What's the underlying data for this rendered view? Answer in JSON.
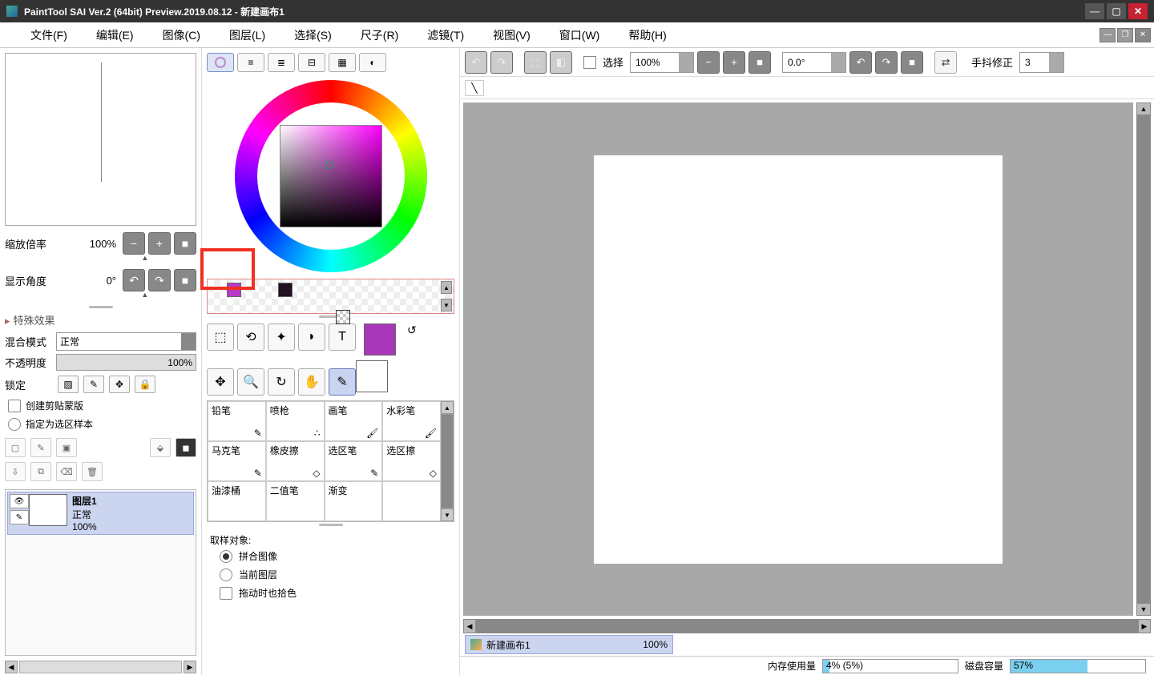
{
  "title": "PaintTool SAI Ver.2 (64bit) Preview.2019.08.12 - 新建画布1",
  "menu": [
    "文件(F)",
    "编辑(E)",
    "图像(C)",
    "图层(L)",
    "选择(S)",
    "尺子(R)",
    "滤镜(T)",
    "视图(V)",
    "窗口(W)",
    "帮助(H)"
  ],
  "nav": {
    "zoom_label": "缩放倍率",
    "zoom_value": "100%",
    "angle_label": "显示角度",
    "angle_value": "0°"
  },
  "fx_header": "特殊效果",
  "blend": {
    "label": "混合模式",
    "value": "正常"
  },
  "opacity": {
    "label": "不透明度",
    "value": "100%"
  },
  "lock_label": "锁定",
  "clip_label": "创建剪贴蒙版",
  "select_src_label": "指定为选区样本",
  "layer": {
    "name": "图层1",
    "mode": "正常",
    "opacity": "100%"
  },
  "brushes": [
    "铅笔",
    "喷枪",
    "画笔",
    "水彩笔",
    "马克笔",
    "橡皮擦",
    "选区笔",
    "选区擦",
    "油漆桶",
    "二值笔",
    "渐变",
    ""
  ],
  "sample": {
    "header": "取样对象:",
    "opt1": "拼合图像",
    "opt2": "当前图层",
    "opt3": "拖动时也拾色"
  },
  "toolbar": {
    "select_label": "选择",
    "zoom": "100%",
    "angle": "0.0°",
    "stab_label": "手抖修正",
    "stab_value": "3"
  },
  "doc_tab": {
    "name": "新建画布1",
    "zoom": "100%"
  },
  "status": {
    "mem_label": "内存使用量",
    "mem_value": "4% (5%)",
    "disk_label": "磁盘容量",
    "disk_value": "57%"
  }
}
